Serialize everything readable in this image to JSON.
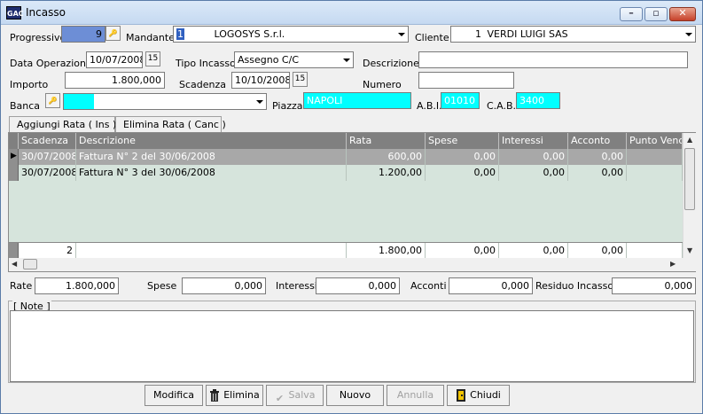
{
  "window": {
    "title": "Incasso",
    "app_icon_text": "GAC"
  },
  "header": {
    "progressivo_label": "Progressivo",
    "progressivo_value": "9",
    "mandante_label": "Mandante",
    "mandante_code": "1",
    "mandante_name": "LOGOSYS S.r.l.",
    "cliente_label": "Cliente",
    "cliente_code": "1",
    "cliente_name": "VERDI LUIGI SAS"
  },
  "form": {
    "data_operazione_label": "Data Operazione",
    "data_operazione_value": "10/07/2008",
    "tipo_incasso_label": "Tipo Incasso",
    "tipo_incasso_value": "Assegno C/C",
    "descrizione_label": "Descrizione",
    "descrizione_value": "",
    "importo_label": "Importo",
    "importo_value": "1.800,000",
    "scadenza_label": "Scadenza",
    "scadenza_value": "10/10/2008",
    "numero_label": "Numero",
    "numero_value": "",
    "banca_label": "Banca",
    "banca_value": "",
    "piazza_label": "Piazza",
    "piazza_value": "NAPOLI",
    "abi_label": "A.B.I.",
    "abi_value": "01010",
    "cab_label": "C.A.B.",
    "cab_value": "3400",
    "calendar_icon_text": "15"
  },
  "tabs": [
    "Aggiungi Rata ( Ins )",
    "Elimina Rata ( Canc )"
  ],
  "grid": {
    "columns": [
      "Scadenza",
      "Descrizione",
      "Rata",
      "Spese",
      "Interessi",
      "Acconto",
      "Punto Vendit"
    ],
    "rows": [
      [
        "30/07/2008",
        "Fattura N° 2 del 30/06/2008",
        "600,00",
        "0,00",
        "0,00",
        "0,00",
        ""
      ],
      [
        "30/07/2008",
        "Fattura N° 3 del 30/06/2008",
        "1.200,00",
        "0,00",
        "0,00",
        "0,00",
        ""
      ]
    ],
    "totals": [
      "2",
      "",
      "1.800,00",
      "0,00",
      "0,00",
      "0,00",
      ""
    ]
  },
  "summary": {
    "rate_label": "Rate",
    "rate_value": "1.800,000",
    "spese_label": "Spese",
    "spese_value": "0,000",
    "interessi_label": "Interessi",
    "interessi_value": "0,000",
    "acconti_label": "Acconti",
    "acconti_value": "0,000",
    "residuo_label": "Residuo Incasso",
    "residuo_value": "0,000"
  },
  "notes": {
    "label": "[ Note ]",
    "value": ""
  },
  "buttons": {
    "modifica": "Modifica",
    "elimina": "Elimina",
    "salva": "Salva",
    "nuovo": "Nuovo",
    "annulla": "Annulla",
    "chiudi": "Chiudi"
  },
  "colors": {
    "cyan_field": "#00ffff",
    "progressivo_bg": "#6d8ed6",
    "grid_header": "#808080",
    "grid_body": "#d6e4dc",
    "selected_row": "#a8a8a8"
  }
}
